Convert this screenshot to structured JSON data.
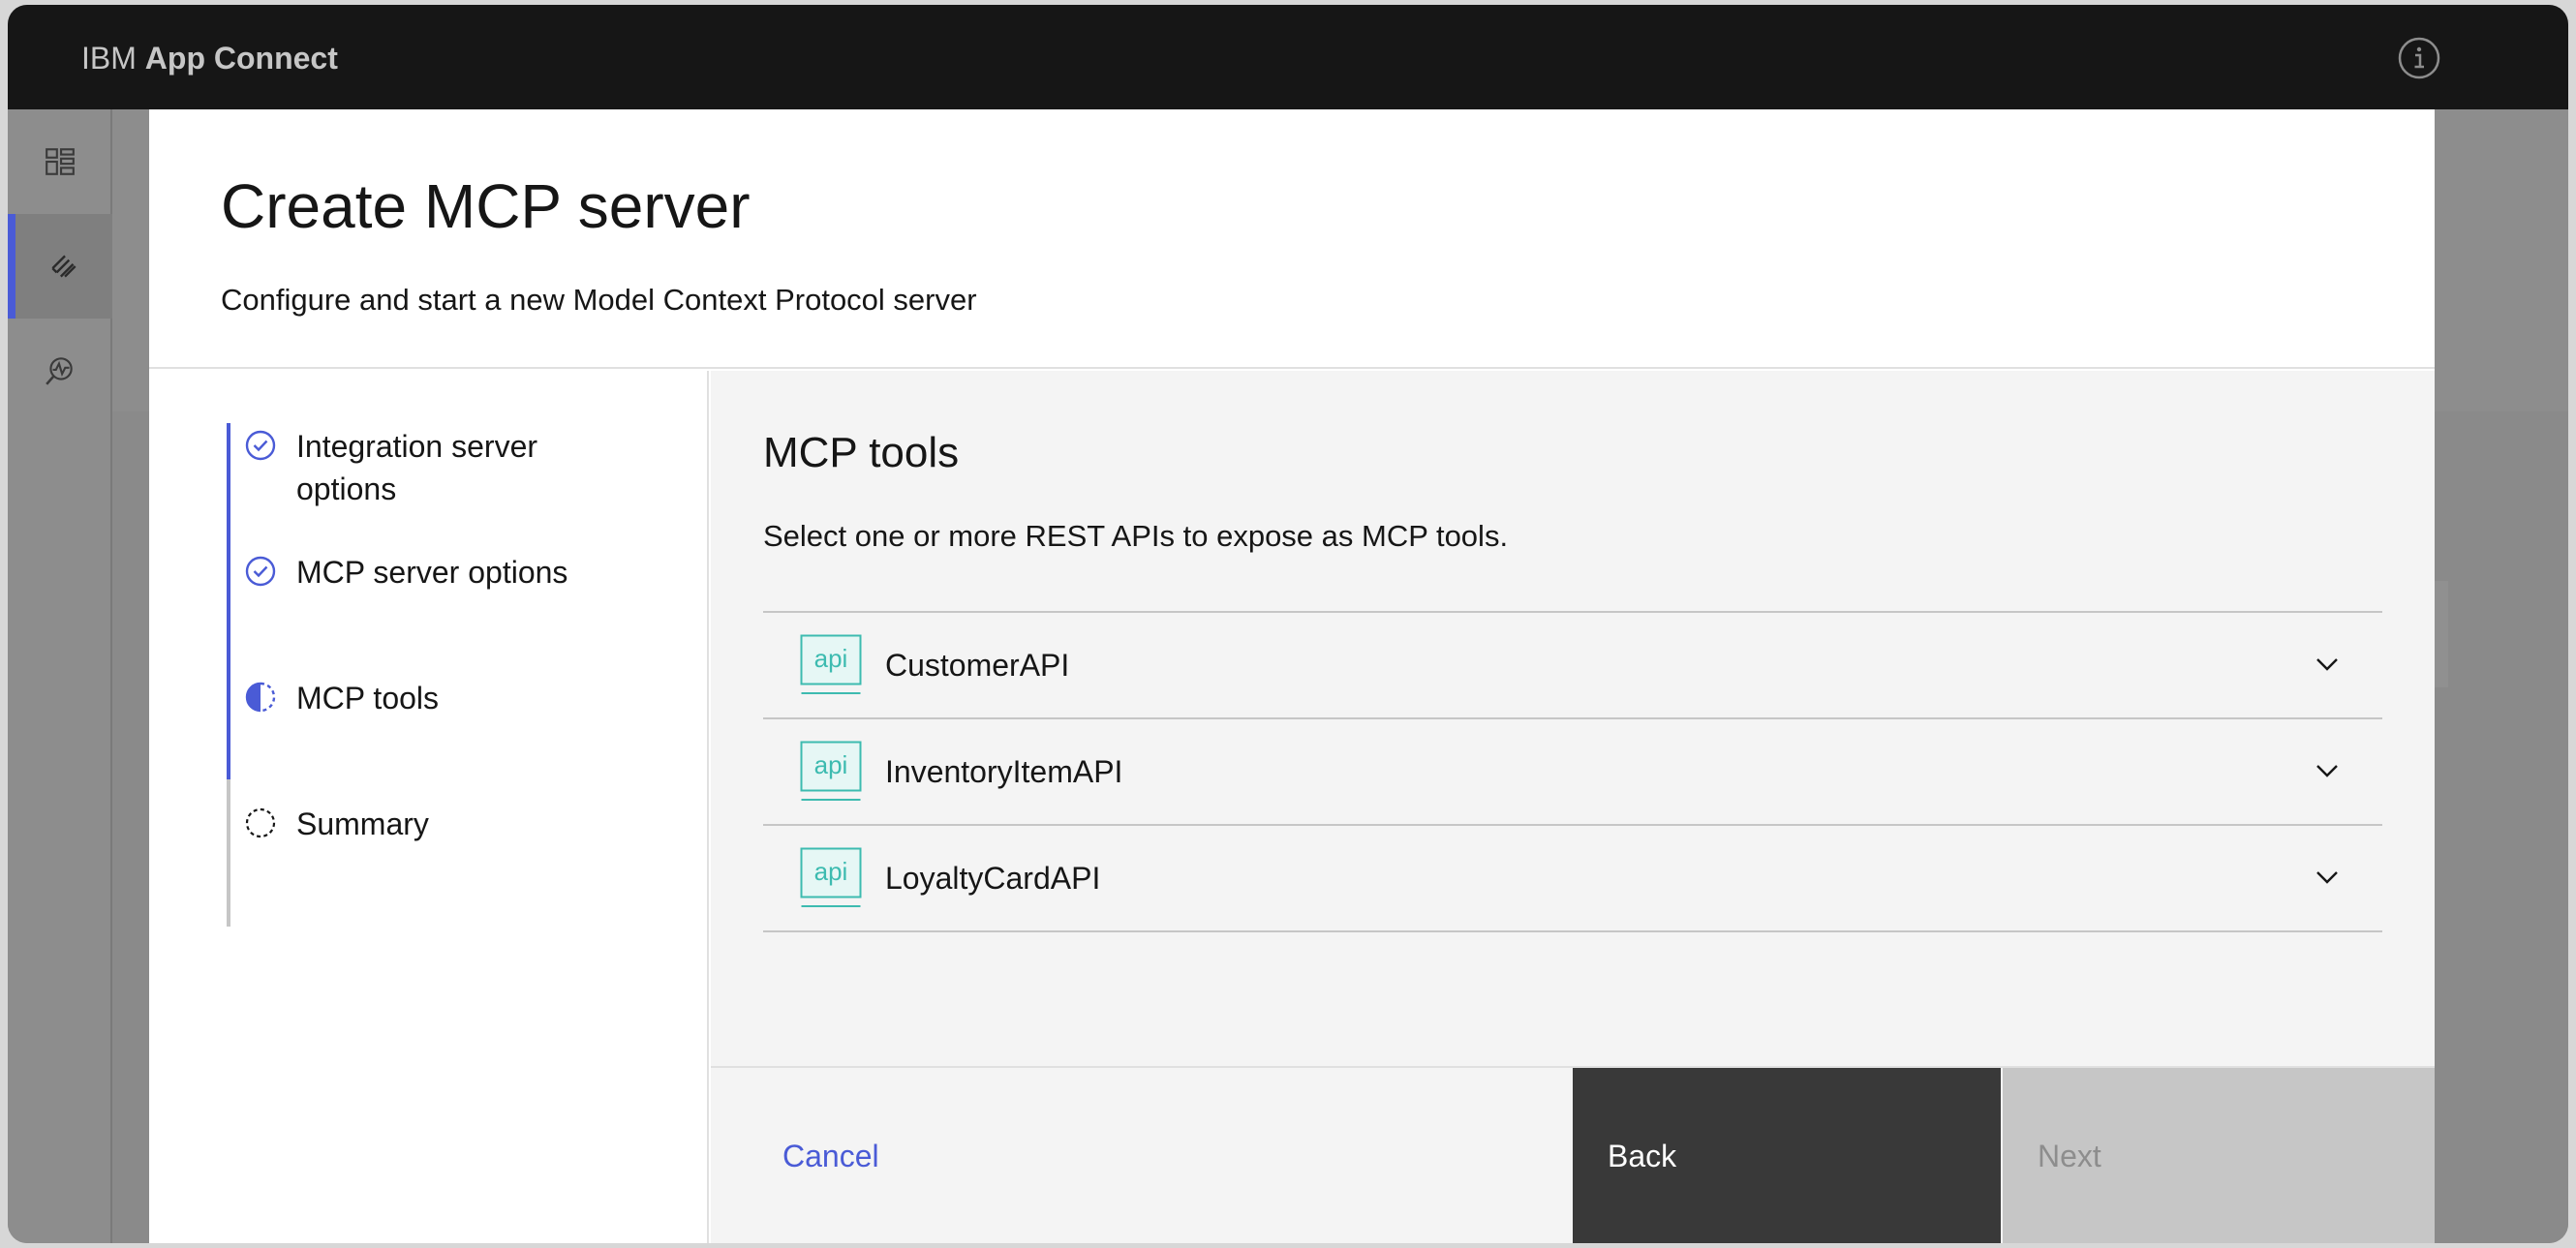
{
  "app": {
    "brand_prefix": "IBM",
    "brand_name": "App Connect"
  },
  "icons": {
    "info": "information-icon",
    "rail": [
      "dashboard-icon",
      "api-tools-icon",
      "monitoring-icon"
    ],
    "step_complete": "checkmark-outline-icon",
    "step_current": "incomplete-circle-icon",
    "step_pending": "dashed-circle-icon",
    "api": "api-icon",
    "expand": "chevron-down-icon"
  },
  "colors": {
    "accent": "#4a5bd6",
    "topbar": "#161616",
    "api_badge": "#3dbbb0"
  },
  "modal": {
    "title": "Create MCP server",
    "subtitle": "Configure and start a new Model Context Protocol server"
  },
  "steps": [
    {
      "label": "Integration server options",
      "state": "complete"
    },
    {
      "label": "MCP server options",
      "state": "complete"
    },
    {
      "label": "MCP tools",
      "state": "current"
    },
    {
      "label": "Summary",
      "state": "pending"
    }
  ],
  "content": {
    "title": "MCP tools",
    "description": "Select one or more REST APIs to expose as MCP tools.",
    "api_badge_text": "api",
    "apis": [
      {
        "name": "CustomerAPI"
      },
      {
        "name": "InventoryItemAPI"
      },
      {
        "name": "LoyaltyCardAPI"
      }
    ]
  },
  "footer": {
    "cancel_label": "Cancel",
    "back_label": "Back",
    "next_label": "Next"
  }
}
